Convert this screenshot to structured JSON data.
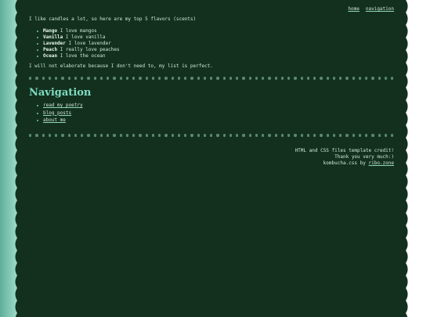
{
  "topnav": {
    "home": "home",
    "navigation": "navigation"
  },
  "intro": "I like candles a lot, so here are my top 5 flavors (scents)",
  "flavors": [
    {
      "name": "Mango",
      "desc": "I love mangos"
    },
    {
      "name": "Vanilla",
      "desc": "I love vanilla"
    },
    {
      "name": "Lavender",
      "desc": "I love lavender"
    },
    {
      "name": "Peach",
      "desc": "I really love peaches"
    },
    {
      "name": "Ocean",
      "desc": "I love the ocean"
    }
  ],
  "note": "I will not elaborate because I don't need to, my list is perfect.",
  "nav_section": {
    "heading": "Navigation",
    "links": [
      "read my poetry",
      "blog posts",
      "about me"
    ]
  },
  "credits": {
    "line1": "HTML and CSS files template credit!",
    "line2": "Thank you very much:)",
    "line3_prefix": "kombucha.css by",
    "line3_link": "ribo.zone"
  },
  "colors": {
    "background": "#13301f",
    "text": "#cfe7d6",
    "heading": "#7fdcc0",
    "accent": "#8fd6b8"
  }
}
